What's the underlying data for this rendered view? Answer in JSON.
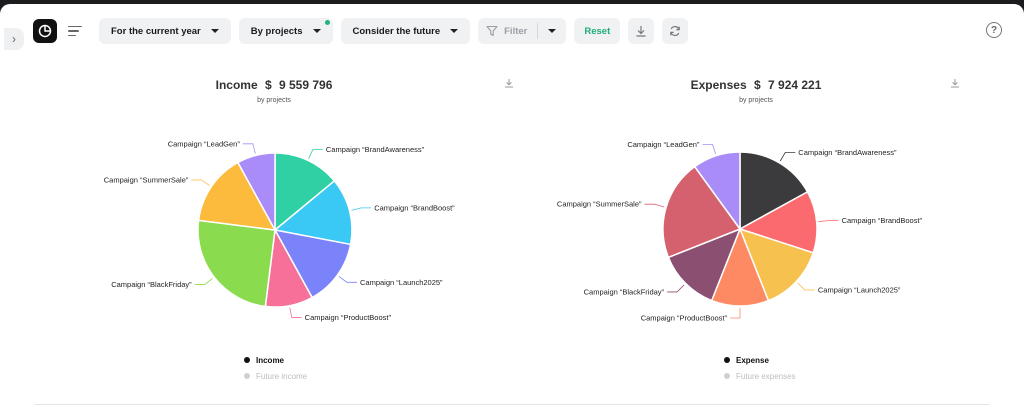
{
  "toolbar": {
    "period": "For the current year",
    "grouping": "By projects",
    "future": "Consider the future",
    "filter": "Filter",
    "reset": "Reset"
  },
  "colors": {
    "accent": "#22b07d",
    "chip_bg": "#f0f1f3"
  },
  "icons": {
    "sidebar_toggle": "chevron-right-icon",
    "logo": "pie-chart-icon",
    "menu": "sort-lines-icon",
    "filter": "funnel-icon",
    "download": "download-icon",
    "refresh": "refresh-icon",
    "help": "question-icon"
  },
  "income_panel": {
    "title": "Income",
    "currency": "$",
    "total": "9 559 796",
    "subtitle": "by projects",
    "legend": [
      {
        "label": "Income",
        "active": true,
        "color": "#111111"
      },
      {
        "label": "Future income",
        "active": false,
        "color": "#d0d0d0"
      }
    ]
  },
  "expenses_panel": {
    "title": "Expenses",
    "currency": "$",
    "total": "7 924 221",
    "subtitle": "by projects",
    "legend": [
      {
        "label": "Expense",
        "active": true,
        "color": "#111111"
      },
      {
        "label": "Future expenses",
        "active": false,
        "color": "#d0d0d0"
      }
    ]
  },
  "chart_data": [
    {
      "type": "pie",
      "title": "Income $ 9 559 796",
      "subtitle": "by projects",
      "slices": [
        {
          "label": "Campaign “BrandAwareness”",
          "value": 14,
          "color": "#2fd1a4"
        },
        {
          "label": "Campaign “BrandBoost”",
          "value": 14,
          "color": "#3ac8f5"
        },
        {
          "label": "Campaign “Launch2025”",
          "value": 14,
          "color": "#7b83fb"
        },
        {
          "label": "Campaign “ProductBoost”",
          "value": 10,
          "color": "#f6709a"
        },
        {
          "label": "Campaign “BlackFriday”",
          "value": 25,
          "color": "#8bdb4e"
        },
        {
          "label": "Campaign “SummerSale”",
          "value": 15,
          "color": "#fdbb3d"
        },
        {
          "label": "Campaign “LeadGen”",
          "value": 8,
          "color": "#a98cf7"
        }
      ]
    },
    {
      "type": "pie",
      "title": "Expenses $ 7 924 221",
      "subtitle": "by projects",
      "slices": [
        {
          "label": "Campaign “BrandAwareness”",
          "value": 17,
          "color": "#3b3b3d"
        },
        {
          "label": "Campaign “BrandBoost”",
          "value": 13,
          "color": "#fb6a6e"
        },
        {
          "label": "Campaign “Launch2025”",
          "value": 14,
          "color": "#f7c14f"
        },
        {
          "label": "Campaign “ProductBoost”",
          "value": 12,
          "color": "#fd8a63"
        },
        {
          "label": "Campaign “BlackFriday”",
          "value": 13,
          "color": "#8b4f72"
        },
        {
          "label": "Campaign “SummerSale”",
          "value": 21,
          "color": "#d5616f"
        },
        {
          "label": "Campaign “LeadGen”",
          "value": 10,
          "color": "#a98cf7"
        }
      ]
    }
  ]
}
